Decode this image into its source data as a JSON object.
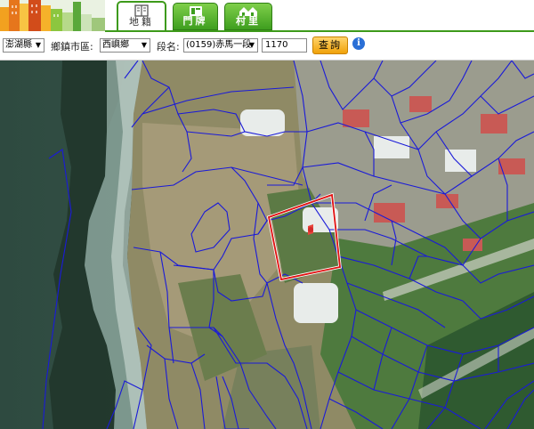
{
  "tabs": [
    {
      "label": "地籍",
      "icon": "map-book-icon",
      "active": true
    },
    {
      "label": "門牌",
      "icon": "door-plate-icon",
      "active": false
    },
    {
      "label": "村里",
      "icon": "village-houses-icon",
      "active": false
    }
  ],
  "search": {
    "county": "澎湖縣",
    "town_label": "鄉鎮市區:",
    "town": "西嶼鄉",
    "section_label": "段名:",
    "section": "(0159)赤馬一段",
    "parcel_number": "1170",
    "query_button": "查詢",
    "info_icon": "info-icon"
  },
  "colors": {
    "tab_green": "#3e9e1f",
    "query_button": "#f0a20a",
    "parcel_lines": "#1a1ad8",
    "highlight_parcel": "#e01010"
  }
}
